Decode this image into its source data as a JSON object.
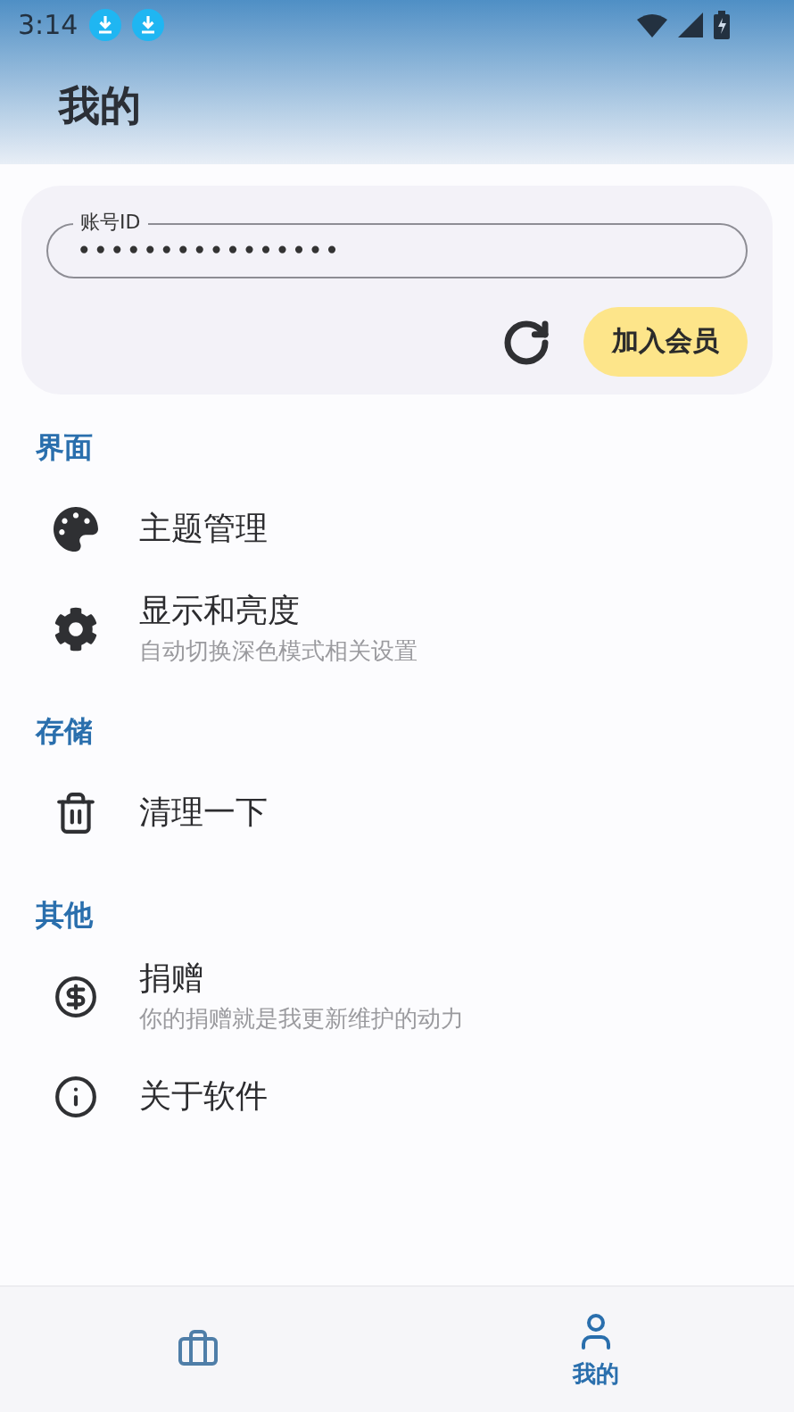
{
  "status_bar": {
    "time": "3:14",
    "notifications": [
      {
        "kind": "download"
      },
      {
        "kind": "download"
      }
    ]
  },
  "app_bar": {
    "title": "我的"
  },
  "account": {
    "label": "账号ID",
    "value": "••••••••••••••••",
    "join_button": "加入会员"
  },
  "sections": [
    {
      "title": "界面",
      "items": [
        {
          "title": "主题管理"
        },
        {
          "title": "显示和亮度",
          "subtitle": "自动切换深色模式相关设置"
        }
      ]
    },
    {
      "title": "存储",
      "items": [
        {
          "title": "清理一下"
        }
      ]
    },
    {
      "title": "其他",
      "items": [
        {
          "title": "捐赠",
          "subtitle": "你的捐赠就是我更新维护的动力"
        },
        {
          "title": "关于软件"
        }
      ]
    }
  ],
  "bottom_nav": [
    {
      "selected": false
    },
    {
      "label": "我的",
      "selected": true
    }
  ]
}
